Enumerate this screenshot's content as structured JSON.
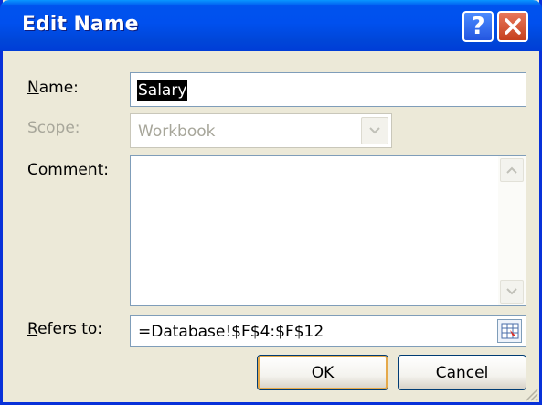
{
  "window": {
    "title": "Edit Name",
    "help_glyph": "?",
    "close_icon": "close-icon"
  },
  "fields": {
    "name": {
      "label_underlined": "N",
      "label_rest": "ame:",
      "value": "Salary"
    },
    "scope": {
      "label": "Scope:",
      "value": "Workbook",
      "disabled": true
    },
    "comment": {
      "label_first": "C",
      "label_underlined": "o",
      "label_rest": "mment:",
      "value": ""
    },
    "refers_to": {
      "label_underlined": "R",
      "label_rest": "efers to:",
      "value": "=Database!$F$4:$F$12"
    }
  },
  "buttons": {
    "ok": "OK",
    "cancel": "Cancel"
  },
  "colors": {
    "title_bar": "#0053ee",
    "dialog_bg": "#ece9d8",
    "close_button": "#c5401d",
    "disabled_text": "#a7a69a"
  }
}
